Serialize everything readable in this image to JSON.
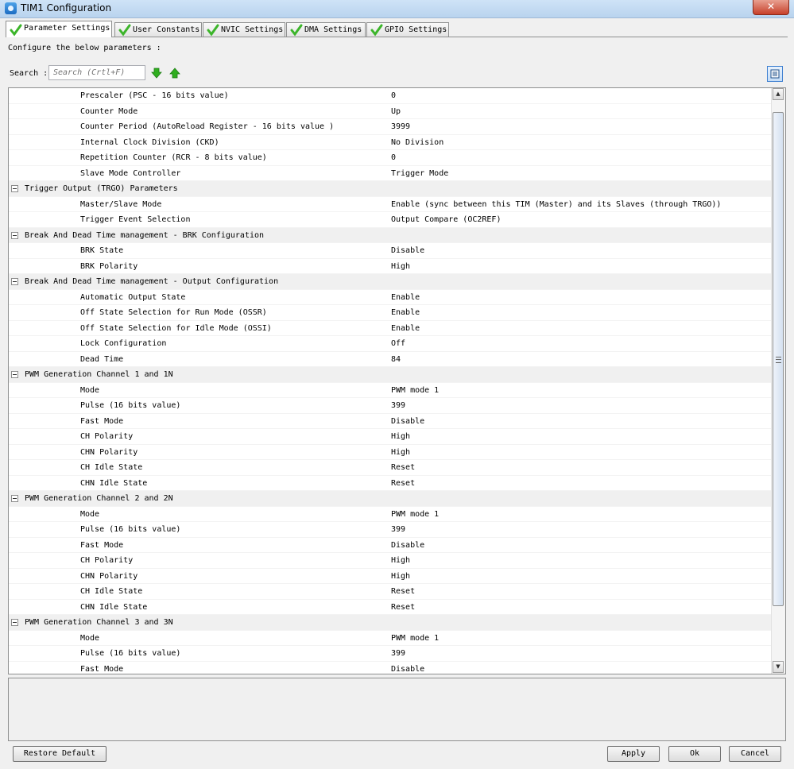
{
  "window": {
    "title": "TIM1 Configuration",
    "close_glyph": "✕"
  },
  "tabs": [
    {
      "label": "Parameter Settings",
      "active": true
    },
    {
      "label": "User Constants",
      "active": false
    },
    {
      "label": "NVIC Settings",
      "active": false
    },
    {
      "label": "DMA Settings",
      "active": false
    },
    {
      "label": "GPIO Settings",
      "active": false
    }
  ],
  "description": "Configure the below parameters :",
  "search": {
    "label": "Search :",
    "placeholder": "Search (Crtl+F)"
  },
  "rows": [
    {
      "type": "param",
      "name": "Prescaler (PSC - 16 bits value)",
      "value": "0"
    },
    {
      "type": "param",
      "name": "Counter Mode",
      "value": "Up"
    },
    {
      "type": "param",
      "name": "Counter Period (AutoReload Register - 16 bits value )",
      "value": "3999"
    },
    {
      "type": "param",
      "name": "Internal Clock Division (CKD)",
      "value": "No Division"
    },
    {
      "type": "param",
      "name": "Repetition Counter (RCR - 8 bits value)",
      "value": "0"
    },
    {
      "type": "param",
      "name": "Slave Mode Controller",
      "value": "Trigger Mode"
    },
    {
      "type": "group",
      "name": "Trigger Output (TRGO) Parameters"
    },
    {
      "type": "param",
      "name": "Master/Slave Mode",
      "value": "Enable (sync between this TIM (Master) and its Slaves (through TRGO))"
    },
    {
      "type": "param",
      "name": "Trigger Event Selection",
      "value": "Output Compare (OC2REF)"
    },
    {
      "type": "group",
      "name": "Break And Dead Time management - BRK Configuration"
    },
    {
      "type": "param",
      "name": "BRK State",
      "value": "Disable"
    },
    {
      "type": "param",
      "name": "BRK Polarity",
      "value": "High"
    },
    {
      "type": "group",
      "name": "Break And Dead Time management - Output Configuration"
    },
    {
      "type": "param",
      "name": "Automatic Output State",
      "value": "Enable"
    },
    {
      "type": "param",
      "name": "Off State Selection for Run Mode (OSSR)",
      "value": "Enable"
    },
    {
      "type": "param",
      "name": "Off State Selection for Idle Mode (OSSI)",
      "value": "Enable"
    },
    {
      "type": "param",
      "name": "Lock Configuration",
      "value": "Off"
    },
    {
      "type": "param",
      "name": "Dead Time",
      "value": "84"
    },
    {
      "type": "group",
      "name": "PWM Generation Channel 1 and 1N"
    },
    {
      "type": "param",
      "name": "Mode",
      "value": "PWM mode 1"
    },
    {
      "type": "param",
      "name": "Pulse (16 bits value)",
      "value": "399"
    },
    {
      "type": "param",
      "name": "Fast Mode",
      "value": "Disable"
    },
    {
      "type": "param",
      "name": "CH Polarity",
      "value": "High"
    },
    {
      "type": "param",
      "name": "CHN Polarity",
      "value": "High"
    },
    {
      "type": "param",
      "name": "CH Idle State",
      "value": "Reset"
    },
    {
      "type": "param",
      "name": "CHN Idle State",
      "value": "Reset"
    },
    {
      "type": "group",
      "name": "PWM Generation Channel 2 and 2N"
    },
    {
      "type": "param",
      "name": "Mode",
      "value": "PWM mode 1"
    },
    {
      "type": "param",
      "name": "Pulse (16 bits value)",
      "value": "399"
    },
    {
      "type": "param",
      "name": "Fast Mode",
      "value": "Disable"
    },
    {
      "type": "param",
      "name": "CH Polarity",
      "value": "High"
    },
    {
      "type": "param",
      "name": "CHN Polarity",
      "value": "High"
    },
    {
      "type": "param",
      "name": "CH Idle State",
      "value": "Reset"
    },
    {
      "type": "param",
      "name": "CHN Idle State",
      "value": "Reset"
    },
    {
      "type": "group",
      "name": "PWM Generation Channel 3 and 3N"
    },
    {
      "type": "param",
      "name": "Mode",
      "value": "PWM mode 1"
    },
    {
      "type": "param",
      "name": "Pulse (16 bits value)",
      "value": "399"
    },
    {
      "type": "param",
      "name": "Fast Mode",
      "value": "Disable"
    }
  ],
  "scrollbar": {
    "up_glyph": "▲",
    "down_glyph": "▼"
  },
  "buttons": {
    "restore": "Restore Default",
    "apply": "Apply",
    "ok": "Ok",
    "cancel": "Cancel"
  },
  "colors": {
    "check_green": "#3cb52a",
    "arrow_green": "#2fae1f",
    "group_bg": "#f0f0f0"
  }
}
